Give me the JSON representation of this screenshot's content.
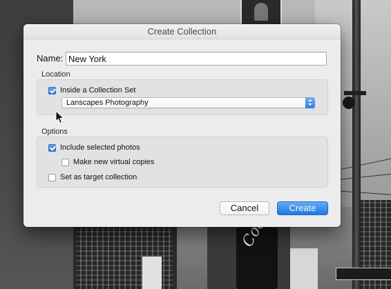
{
  "dialog": {
    "title": "Create Collection",
    "name_label": "Name:",
    "name_value": "New York",
    "location": {
      "section_label": "Location",
      "inside_set_label": "Inside a Collection Set",
      "inside_set_checked": true,
      "collection_set_selected": "Lanscapes Photography"
    },
    "options": {
      "section_label": "Options",
      "include_selected_label": "Include selected photos",
      "include_selected_checked": true,
      "virtual_copies_label": "Make new virtual copies",
      "virtual_copies_checked": false,
      "target_collection_label": "Set as target collection",
      "target_collection_checked": false
    },
    "buttons": {
      "cancel_label": "Cancel",
      "create_label": "Create"
    }
  },
  "background": {
    "sign_text": "Coca-Cola"
  },
  "colors": {
    "accent": "#2c7be5",
    "dialog_bg": "#ececec",
    "group_bg": "#e2e2e2"
  },
  "icons": {
    "checkbox_checked": "checkmark-icon",
    "select_arrows": "up-down-chevron-icon",
    "pointer": "mouse-cursor-icon"
  }
}
